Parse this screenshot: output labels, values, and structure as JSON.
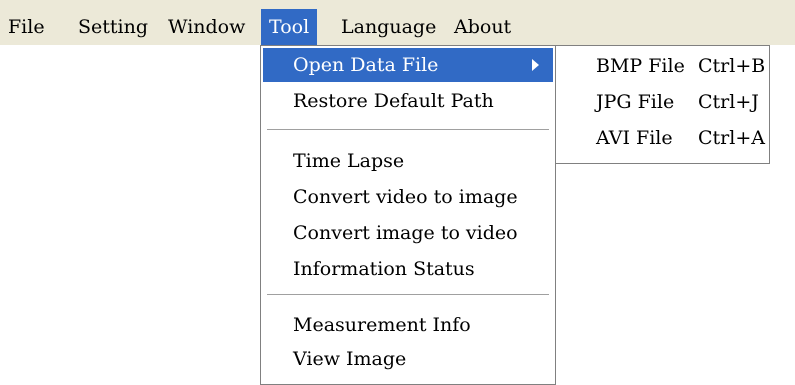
{
  "menubar": {
    "items": [
      {
        "label": "File"
      },
      {
        "label": "Setting"
      },
      {
        "label": "Window"
      },
      {
        "label": "Tool"
      },
      {
        "label": "Language"
      },
      {
        "label": "About"
      }
    ]
  },
  "tool_menu": {
    "items": [
      {
        "label": "Open Data File"
      },
      {
        "label": "Restore Default Path"
      },
      {
        "label": "Time Lapse"
      },
      {
        "label": "Convert video to image"
      },
      {
        "label": "Convert image to video"
      },
      {
        "label": "Information Status"
      },
      {
        "label": "Measurement Info"
      },
      {
        "label": "View Image"
      }
    ]
  },
  "submenu": {
    "items": [
      {
        "label": "BMP File",
        "shortcut": "Ctrl+B"
      },
      {
        "label": "JPG File",
        "shortcut": "Ctrl+J"
      },
      {
        "label": "AVI File",
        "shortcut": "Ctrl+A"
      }
    ]
  },
  "colors": {
    "highlight": "#316ac5",
    "menubar_bg": "#ece9d8"
  },
  "icons": {
    "submenu_arrow": "chevron-right-icon"
  }
}
